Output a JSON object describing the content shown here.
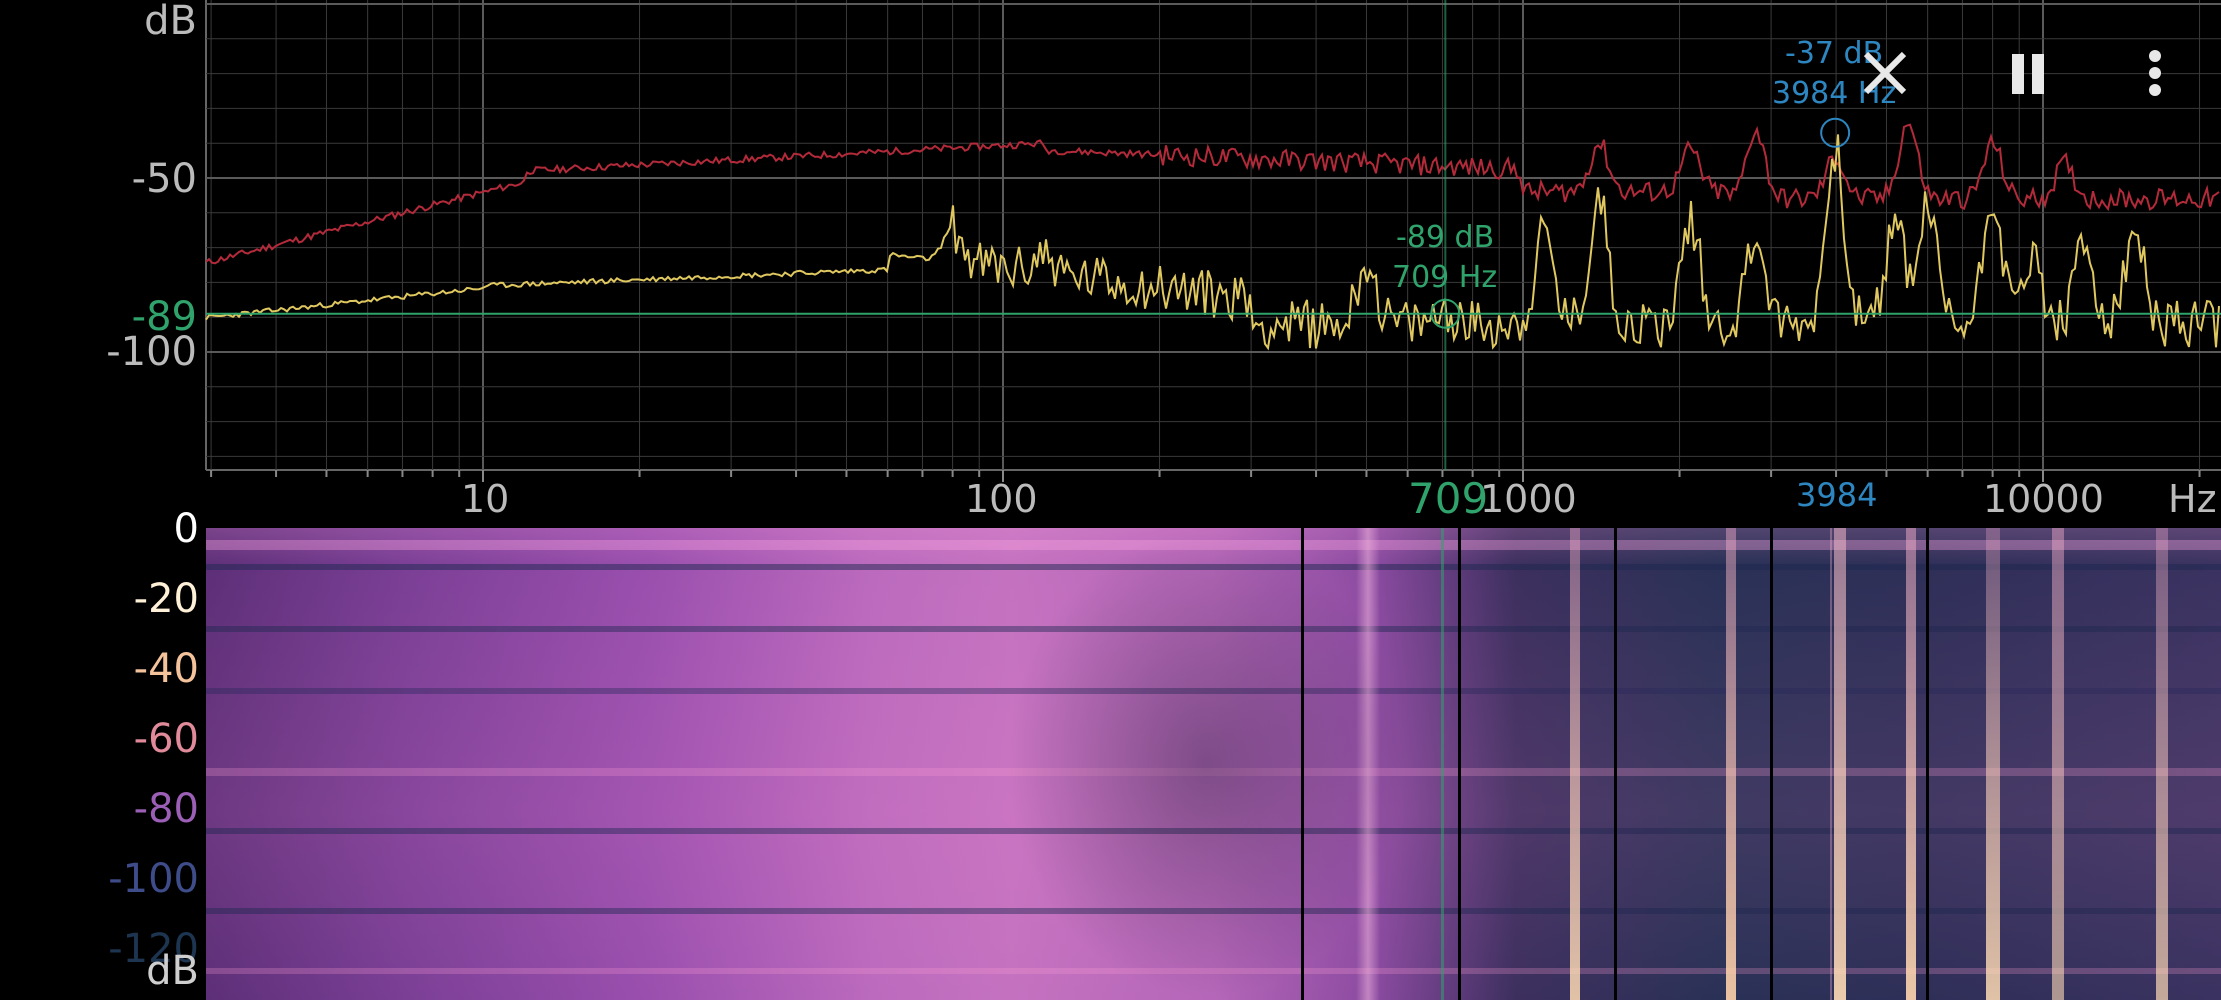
{
  "top_axis": {
    "unit": "dB",
    "labels": [
      {
        "text": "-50",
        "db": -50
      },
      {
        "text": "-100",
        "db": -100
      }
    ],
    "marker_db_label": "-89"
  },
  "x_axis": {
    "unit": "Hz",
    "labels": [
      {
        "text": "10",
        "hz": 10
      },
      {
        "text": "100",
        "hz": 100
      },
      {
        "text": "1000",
        "hz": 1000
      },
      {
        "text": "10000",
        "hz": 10000
      }
    ],
    "marker_green": "709",
    "marker_blue": "3984"
  },
  "peak_blue": {
    "db_text": "-37 dB",
    "hz_text": "3984 Hz",
    "db": -37,
    "hz": 3984
  },
  "peak_green": {
    "db_text": "-89 dB",
    "hz_text": "709 Hz",
    "db": -89,
    "hz": 709
  },
  "spectrogram": {
    "unit": "dB",
    "labels": [
      {
        "text": "0",
        "color": "#ffffff"
      },
      {
        "text": "-20",
        "color": "#fff0d8"
      },
      {
        "text": "-40",
        "color": "#f5c39b"
      },
      {
        "text": "-60",
        "color": "#e08a9a"
      },
      {
        "text": "-80",
        "color": "#9b5fb5"
      },
      {
        "text": "-100",
        "color": "#3e4c8a"
      },
      {
        "text": "-120",
        "color": "#1d3550"
      }
    ]
  },
  "controls": {
    "close_icon": "close-icon",
    "pause_icon": "pause-icon",
    "menu_icon": "more-vertical-icon"
  },
  "colors": {
    "peak_hold": "#b32a3a",
    "spectrum": "#e0c860",
    "marker_green": "#2fa36b",
    "marker_blue": "#2e86c1",
    "grid": "#3a3a3a"
  }
}
